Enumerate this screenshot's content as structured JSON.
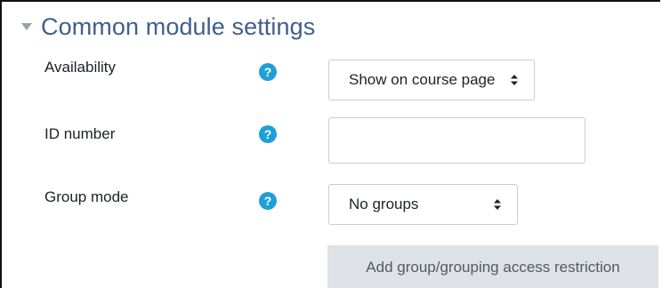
{
  "section": {
    "title": "Common module settings",
    "collapse_icon": "triangle-down-icon"
  },
  "colors": {
    "title": "#3f5f8a",
    "help_icon": "#1f9fd7",
    "button_bg": "#dee2e6",
    "input_border": "#c8cdd2"
  },
  "fields": {
    "availability": {
      "label": "Availability",
      "help_icon": "question-circle-icon",
      "selected": "Show on course page"
    },
    "id_number": {
      "label": "ID number",
      "help_icon": "question-circle-icon",
      "value": "",
      "placeholder": ""
    },
    "group_mode": {
      "label": "Group mode",
      "help_icon": "question-circle-icon",
      "selected": "No groups"
    }
  },
  "buttons": {
    "group_restriction": "Add group/grouping access restriction"
  }
}
